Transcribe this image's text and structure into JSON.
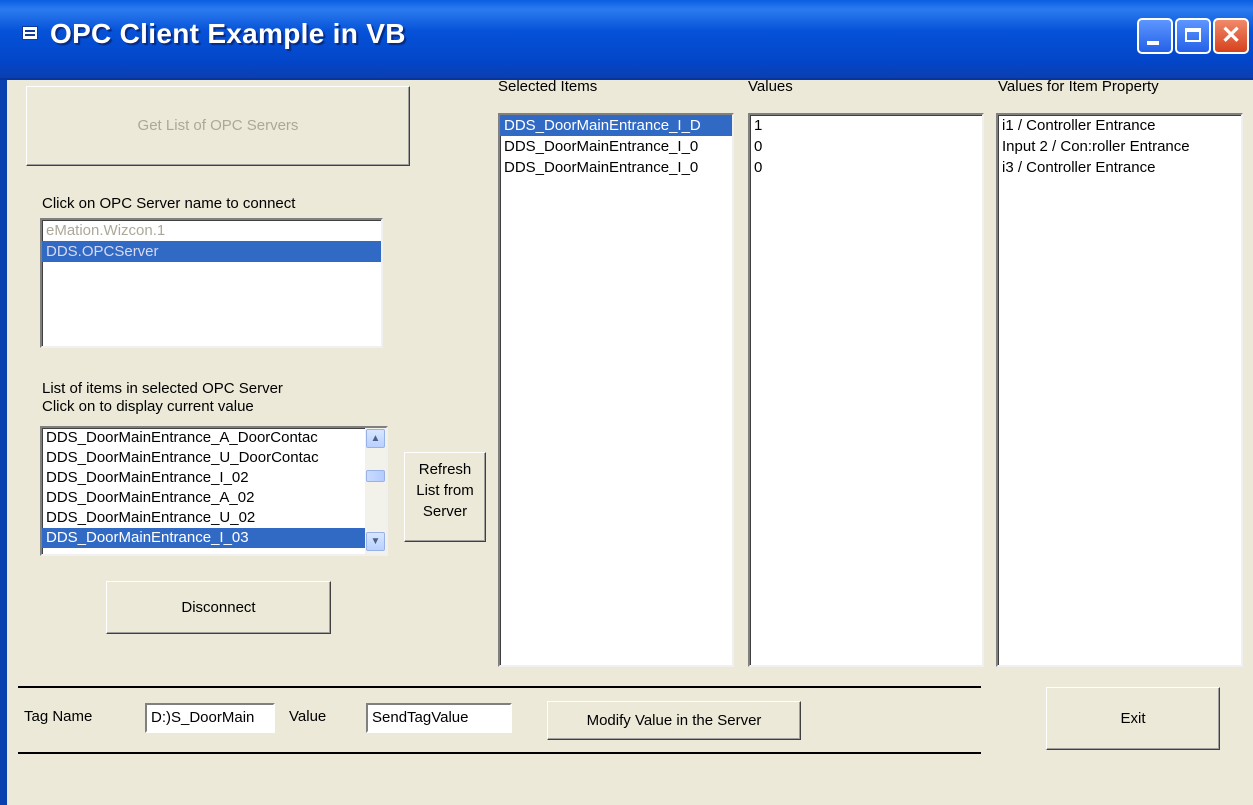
{
  "window": {
    "title": "OPC Client Example in VB",
    "title_icon": "app-window-icon",
    "controls": [
      "minimize-icon",
      "maximize-icon",
      "close-icon"
    ],
    "close_glyph": "✕"
  },
  "left": {
    "get_servers_button": "Get List of OPC Servers",
    "server_prompt": "Click on OPC Server name to connect",
    "servers": [
      "eMation.Wizcon.1",
      "DDS.OPCServer"
    ],
    "items_label_line1": "List of items in selected  OPC Server",
    "items_label_line2": "Click on to display current value",
    "items": [
      "DDS_DoorMainEntrance_A_DoorContac",
      "DDS_DoorMainEntrance_U_DoorContac",
      "DDS_DoorMainEntrance_I_02",
      "DDS_DoorMainEntrance_A_02",
      "DDS_DoorMainEntrance_U_02",
      "DDS_DoorMainEntrance_I_03"
    ],
    "refresh_button": [
      "Refresh",
      "List from",
      "Server"
    ],
    "disconnect_button": "Disconnect"
  },
  "selected_items": {
    "header": "Selected Items",
    "rows": [
      "DDS_DoorMainEntrance_I_D",
      "DDS_DoorMainEntrance_I_0",
      "DDS_DoorMainEntrance_I_0"
    ]
  },
  "values": {
    "header": "Values",
    "rows": [
      "1",
      "0",
      "0"
    ]
  },
  "properties": {
    "header": "Values for Item Property",
    "rows": [
      "i1 / Controller Entrance",
      "Input 2 / Con:roller Entrance",
      "i3 / Controller Entrance"
    ]
  },
  "bottom": {
    "tag_name_label": "Tag Name",
    "tag_name_value": "D:)S_DoorMain",
    "value_label": "Value",
    "value_value": "SendTagValue",
    "modify_button": "Modify Value in the Server",
    "exit_button": "Exit"
  },
  "colors": {
    "title_bar": "#0552d8",
    "selection": "#316ac5",
    "face": "#ece9d8"
  }
}
